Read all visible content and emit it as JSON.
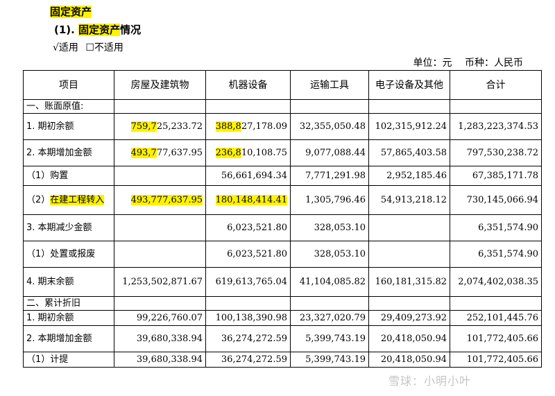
{
  "heading": "固定资产",
  "subheading": {
    "prefix": "(1). ",
    "highlight": "固定资产",
    "suffix": "情况"
  },
  "applicability": {
    "applicable": "√适用",
    "not_applicable": "☐不适用"
  },
  "unit_line": {
    "unit": "单位：元",
    "currency": "币种：人民币"
  },
  "columns": [
    "项目",
    "房屋及建筑物",
    "机器设备",
    "运输工具",
    "电子设备及其他",
    "合计"
  ],
  "rows": [
    {
      "label": "一、账面原值:",
      "values": [
        "",
        "",
        "",
        "",
        ""
      ]
    },
    {
      "label": "1. 期初余额",
      "values": [
        "759,725,233.72",
        "388,827,178.09",
        "32,355,050.48",
        "102,315,912.24",
        "1,283,223,374.53"
      ]
    },
    {
      "label": "2. 本期增加金额",
      "values": [
        "493,777,637.95",
        "236,810,108.75",
        "9,077,088.44",
        "57,865,403.58",
        "797,530,238.72"
      ]
    },
    {
      "label": "（1）购置",
      "values": [
        "",
        "56,661,694.34",
        "7,771,291.98",
        "2,952,185.46",
        "67,385,171.78"
      ]
    },
    {
      "label": "（2）在建工程转入",
      "values": [
        "493,777,637.95",
        "180,148,414.41",
        "1,305,796.46",
        "54,913,218.12",
        "730,145,066.94"
      ]
    },
    {
      "label": "3. 本期减少金额",
      "values": [
        "",
        "6,023,521.80",
        "328,053.10",
        "",
        "6,351,574.90"
      ]
    },
    {
      "label": "（1）处置或报废",
      "values": [
        "",
        "6,023,521.80",
        "328,053.10",
        "",
        "6,351,574.90"
      ]
    },
    {
      "label": "4. 期末余额",
      "values": [
        "1,253,502,871.67",
        "619,613,765.04",
        "41,104,085.82",
        "160,181,315.82",
        "2,074,402,038.35"
      ]
    },
    {
      "label": "二、累计折旧",
      "values": [
        "",
        "",
        "",
        "",
        ""
      ]
    },
    {
      "label": "1. 期初余额",
      "values": [
        "99,226,760.07",
        "100,138,390.98",
        "23,327,020.79",
        "29,409,273.92",
        "252,101,445.76"
      ]
    },
    {
      "label": "2. 本期增加金额",
      "values": [
        "39,680,338.94",
        "36,274,272.59",
        "5,399,743.19",
        "20,418,050.94",
        "101,772,405.66"
      ]
    },
    {
      "label": "（1）计提",
      "values": [
        "39,680,338.94",
        "36,274,272.59",
        "5,399,743.19",
        "20,418,050.94",
        "101,772,405.66"
      ]
    }
  ],
  "watermark": "雪球：小明小叶",
  "highlight_color": "#fff200"
}
